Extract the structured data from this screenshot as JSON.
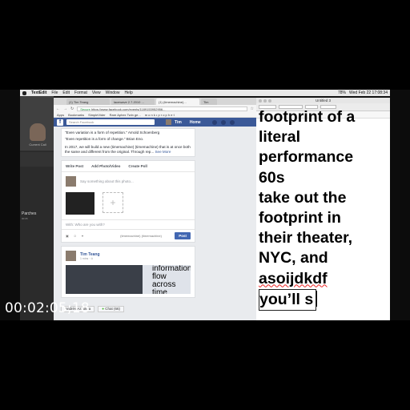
{
  "menubar": {
    "app": "TextEdit",
    "items": [
      "File",
      "Edit",
      "Format",
      "View",
      "Window",
      "Help"
    ],
    "clock": "Wed Feb 22  17:08:34",
    "battery": "78%"
  },
  "call": {
    "self_label": "Current Call",
    "contact_name": "Parches",
    "duration": "00:05"
  },
  "browser": {
    "tabs": [
      "(1) Tim Teang",
      "lacewave 2.7.2010 ...",
      "(1) (timemachine)...",
      "Tim"
    ],
    "url_secure": "Secure",
    "url": "https://www.facebook.com/events/1189153952956...",
    "bookmarks": [
      "Apps",
      "Bookmarks",
      "SimpleVider",
      "Rare Aphex Twin ge...",
      "m o n k • p r o p h e t"
    ],
    "fb": {
      "search_placeholder": "Search Facebook",
      "user": "Tim",
      "home": "Home",
      "quote_lines": [
        "\"Even variation is a form of repetition.\" Arnold Schoenberg",
        "\"Even repetition is a form of change.\" Brian Eno."
      ],
      "para": "In 2017, we will build a new (timemachine) (timemachine) that is at once both the same and different from the original. Through rep...",
      "see_more": "See More",
      "composer_tabs": [
        "Write Post",
        "Add Photo/Video",
        "Create Poll"
      ],
      "say_placeholder": "Say something about this photo...",
      "with_placeholder": "With: Who are you with?",
      "audience": "(timemachine) (timemachine)",
      "post_label": "Post",
      "author": "Tim Teang",
      "author_meta": "1 mins · ⊙",
      "embed_text": [
        "information",
        "flow across",
        "time"
      ],
      "chat_items": [
        "Andrés Azzolina",
        "Chat (66)"
      ]
    }
  },
  "textedit": {
    "title": "Untitled 3",
    "lines": [
      "footprint of a",
      "literal",
      "performance",
      "60s",
      "take out the",
      "footprint in",
      "their theater,",
      "NYC, and",
      "asoijdkdf",
      "you’ll s"
    ]
  },
  "overlay": {
    "timecode": "00:02:05;18"
  }
}
